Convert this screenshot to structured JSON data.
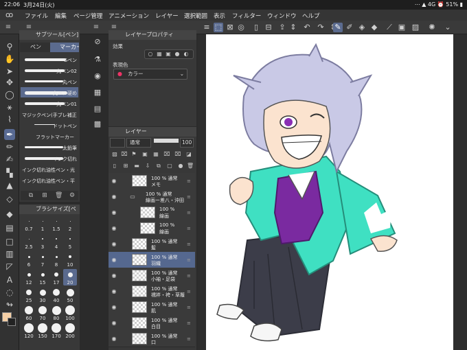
{
  "status": {
    "time": "22:06",
    "date": "3月24日(火)",
    "right": "⋯ ▲ 4G ⏰ 51% ▮"
  },
  "menu": [
    "ファイル",
    "編集",
    "ページ管理",
    "アニメーション",
    "レイヤー",
    "選択範囲",
    "表示",
    "フィルター",
    "ウィンドウ",
    "ヘルプ"
  ],
  "subtool": {
    "title": "サブツール[ペン]",
    "tabs": [
      "ペン",
      "マーカー"
    ],
    "brushes": [
      "Gペン",
      "丸ペン02",
      "丸ペン",
      "丸ペン硬め",
      "丸ペン01",
      "マジックペン(手ブレ補正",
      "ドットペン",
      "フラットマーカー",
      "太鉛筆",
      "インク切れ",
      "インク切れ油性ペン・光",
      "インク切れ油性ペン・平"
    ]
  },
  "brushsize": {
    "title": "ブラシサイズ[ペ",
    "sizes": [
      "0.7",
      "1",
      "1.5",
      "2",
      "2.5",
      "3",
      "4",
      "5",
      "6",
      "7",
      "8",
      "10",
      "12",
      "15",
      "17",
      "20",
      "25",
      "30",
      "40",
      "50",
      "60",
      "70",
      "80",
      "100",
      "120",
      "150",
      "170",
      "200"
    ],
    "selected": "20"
  },
  "layerprop": {
    "title": "レイヤープロパティ",
    "effect_label": "効果",
    "color_label": "表現色",
    "color_value": "カラー"
  },
  "layers": {
    "title": "レイヤー",
    "blend": "通常",
    "opacity": "100",
    "items": [
      {
        "mode": "100 % 通常",
        "name": "メモ",
        "indent": 0,
        "sel": false
      },
      {
        "mode": "100 % 通常",
        "name": "線画ー差八・沖田",
        "indent": 0,
        "sel": false,
        "folder": true
      },
      {
        "mode": "100 %",
        "name": "線画",
        "indent": 1,
        "sel": false
      },
      {
        "mode": "100 %",
        "name": "線画",
        "indent": 1,
        "sel": false
      },
      {
        "mode": "100 % 通常",
        "name": "髪",
        "indent": 0,
        "sel": false
      },
      {
        "mode": "100 % 通常",
        "name": "羽織",
        "indent": 0,
        "sel": true
      },
      {
        "mode": "100 % 通常",
        "name": "小袖・足袋",
        "indent": 0,
        "sel": false
      },
      {
        "mode": "100 % 通常",
        "name": "襦袢・袴・草履",
        "indent": 0,
        "sel": false
      },
      {
        "mode": "100 % 通常",
        "name": "肌",
        "indent": 0,
        "sel": false
      },
      {
        "mode": "100 % 通常",
        "name": "白目",
        "indent": 0,
        "sel": false
      },
      {
        "mode": "100 % 通常",
        "name": "口",
        "indent": 0,
        "sel": false
      }
    ]
  },
  "colors": {
    "accent": "#5b6b8f",
    "main_color": "#f5cfa5",
    "sub_color": "#222222",
    "haori": "#3fe0c2",
    "hakama": "#3c3d49",
    "kosode": "#7a2aa0",
    "hair": "#c9c9e6"
  }
}
